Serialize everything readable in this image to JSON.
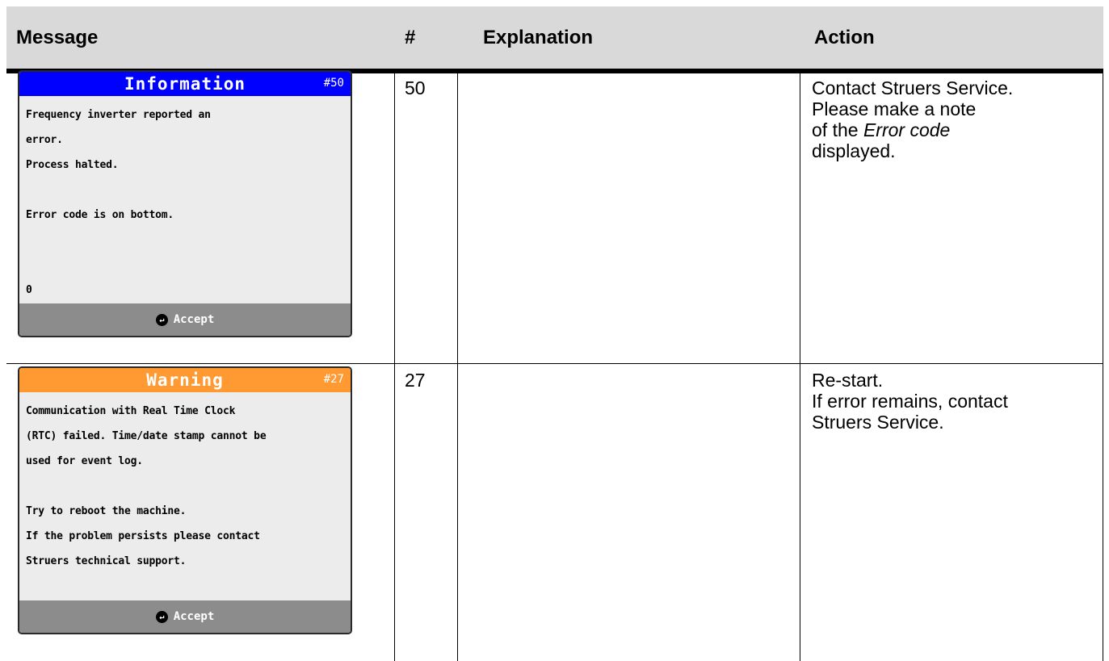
{
  "table": {
    "headers": {
      "message": "Message",
      "number": "#",
      "explanation": "Explanation",
      "action": "Action"
    },
    "rows": [
      {
        "screen": {
          "type": "Information",
          "title": "Information",
          "code": "#50",
          "bar_color": "#0000ff",
          "title_color": "#ffffff",
          "lines": [
            "Frequency inverter reported an",
            "error.",
            "Process halted.",
            "",
            "Error code is on bottom.",
            "",
            "",
            "0"
          ],
          "button": "Accept",
          "button_icon": "enter-icon"
        },
        "number": "50",
        "explanation": "",
        "action": {
          "line1": "Contact Struers Service.",
          "line2": "Please make a note",
          "line3_pre": "of the ",
          "line3_em": "Error code",
          "line4": "displayed."
        }
      },
      {
        "screen": {
          "type": "Warning",
          "title": "Warning",
          "code": "#27",
          "bar_color": "#ff9a33",
          "title_color": "#ffffff",
          "lines": [
            "Communication with Real Time Clock",
            "(RTC) failed. Time/date stamp cannot be",
            "used for event log.",
            "",
            "Try to reboot the machine.",
            "If the problem persists please contact",
            "Struers technical support."
          ],
          "button": "Accept",
          "button_icon": "enter-icon"
        },
        "number": "27",
        "explanation": "",
        "action": {
          "line1": "Re-start.",
          "line2": "If error remains, contact",
          "line3": "Struers Service."
        }
      }
    ]
  }
}
